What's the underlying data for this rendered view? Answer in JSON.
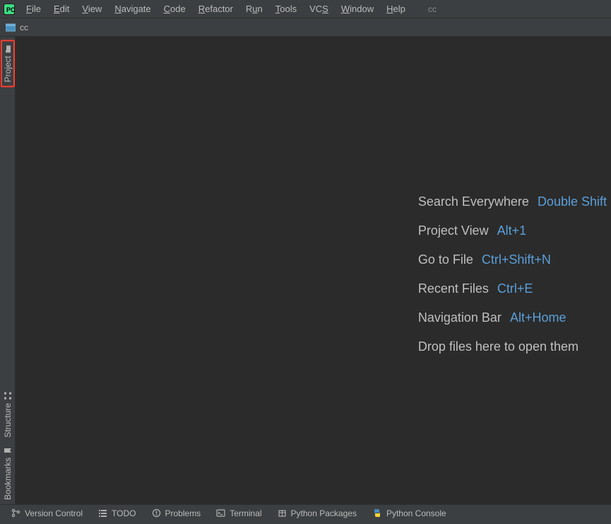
{
  "menu": {
    "file": "File",
    "edit": "Edit",
    "view": "View",
    "navigate": "Navigate",
    "code": "Code",
    "refactor": "Refactor",
    "run": "Run",
    "tools": "Tools",
    "vcs": "VCS",
    "window": "Window",
    "help": "Help",
    "project_label": "cc"
  },
  "navbar": {
    "breadcrumb": "cc"
  },
  "left_strip": {
    "project": "Project",
    "structure": "Structure",
    "bookmarks": "Bookmarks"
  },
  "welcome": {
    "rows": [
      {
        "label": "Search Everywhere",
        "shortcut": "Double Shift"
      },
      {
        "label": "Project View",
        "shortcut": "Alt+1"
      },
      {
        "label": "Go to File",
        "shortcut": "Ctrl+Shift+N"
      },
      {
        "label": "Recent Files",
        "shortcut": "Ctrl+E"
      },
      {
        "label": "Navigation Bar",
        "shortcut": "Alt+Home"
      }
    ],
    "drop_hint": "Drop files here to open them"
  },
  "bottom_strip": {
    "version_control": "Version Control",
    "todo": "TODO",
    "problems": "Problems",
    "terminal": "Terminal",
    "python_packages": "Python Packages",
    "python_console": "Python Console"
  },
  "colors": {
    "bg_chrome": "#3c3f41",
    "bg_editor": "#2b2b2b",
    "text": "#bbbbbb",
    "link": "#5b9fd9",
    "highlight_border": "#ff3b30"
  }
}
